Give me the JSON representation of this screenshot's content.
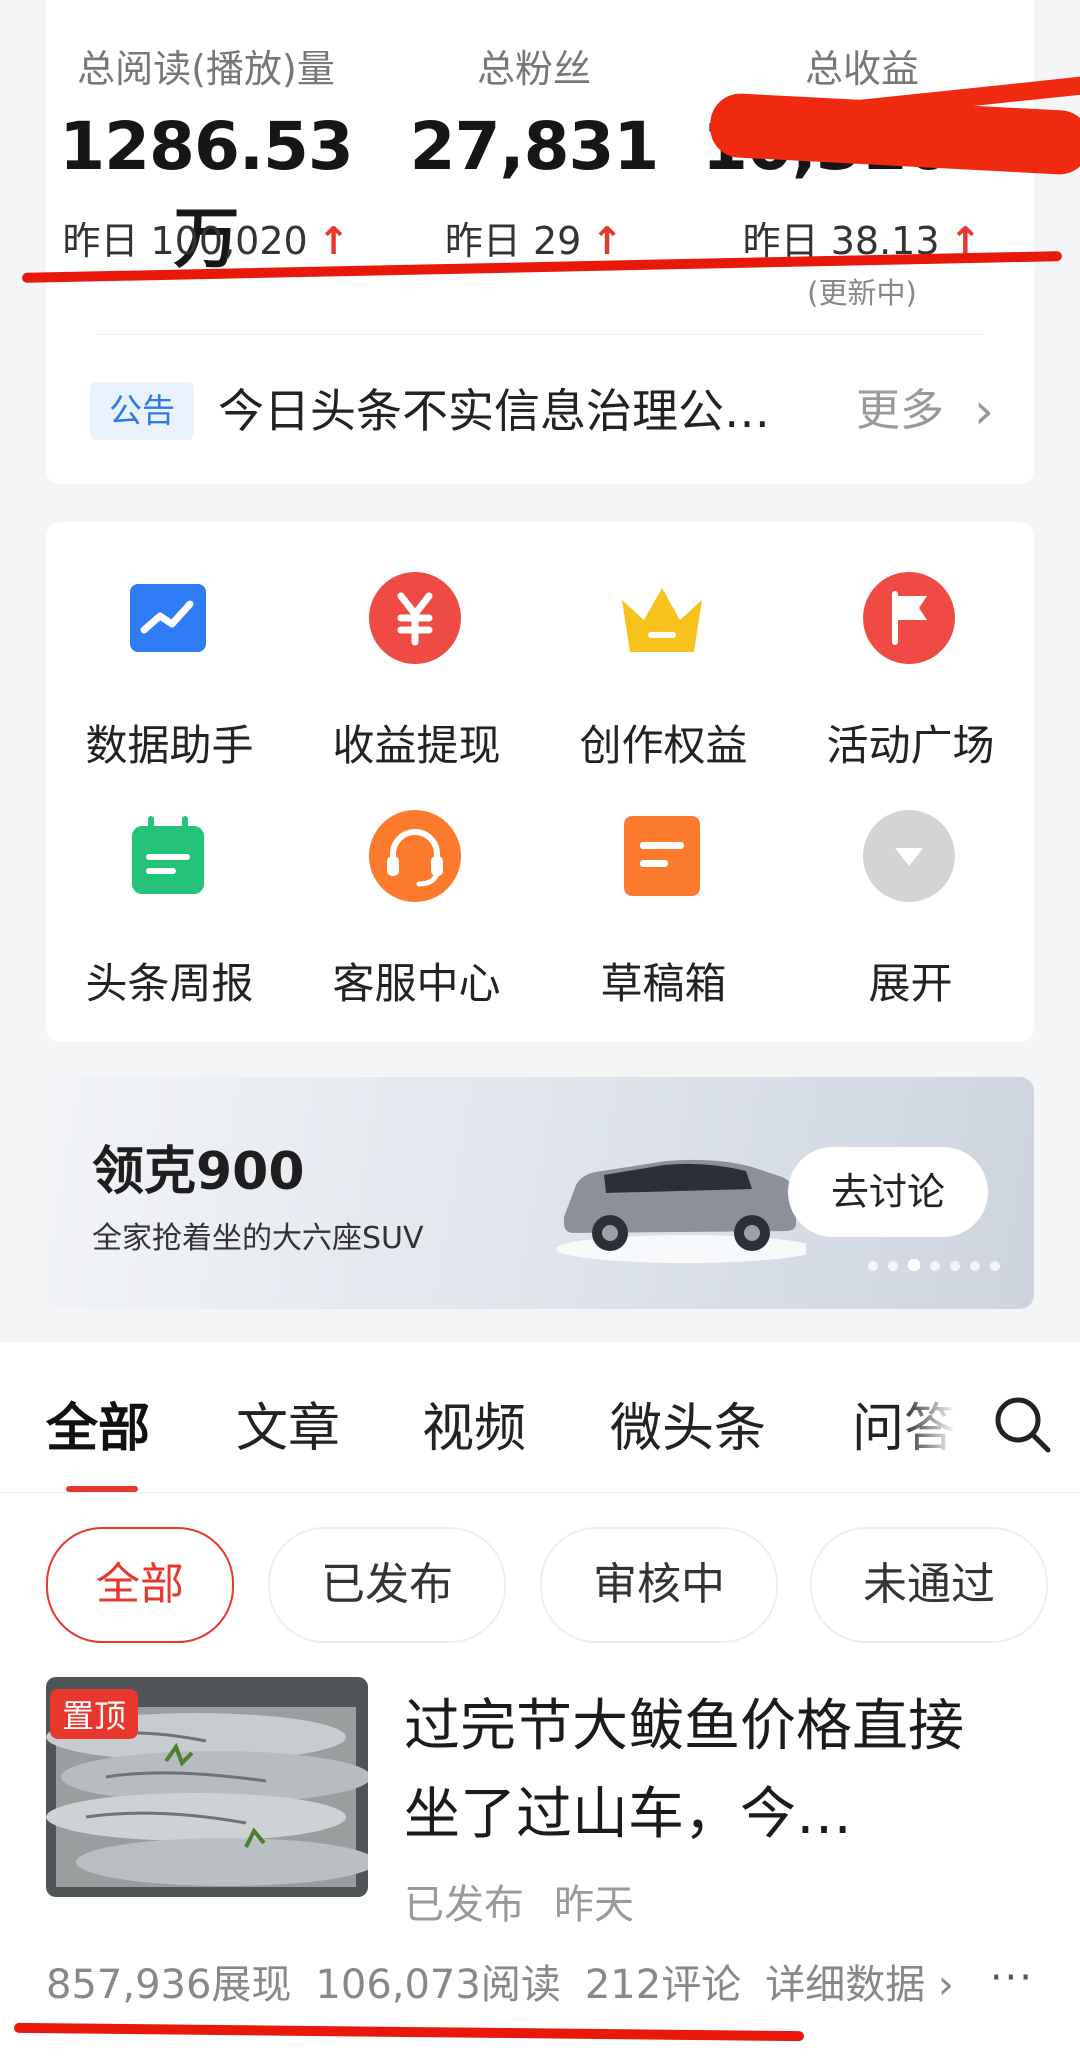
{
  "stats": {
    "items": [
      {
        "label": "总阅读(播放)量",
        "value": "1286.53万",
        "yesterday": "昨日 100,020",
        "arrow": "↑"
      },
      {
        "label": "总粉丝",
        "value": "27,831",
        "yesterday": "昨日 29",
        "arrow": "↑"
      },
      {
        "label": "总收益",
        "value": "10,310.28",
        "yesterday": "昨日 38.13",
        "arrow": "↑",
        "note": "(更新中)"
      }
    ]
  },
  "notice": {
    "tag": "公告",
    "text": "今日头条不实信息治理公…",
    "more": "更多",
    "chevron": "›"
  },
  "tools": [
    {
      "label": "数据助手",
      "icon": "chart-trend-icon",
      "color": "#2f7cf6"
    },
    {
      "label": "收益提现",
      "icon": "yuan-icon",
      "color": "#f04a45"
    },
    {
      "label": "创作权益",
      "icon": "crown-icon",
      "color": "#f7c21b"
    },
    {
      "label": "活动广场",
      "icon": "flag-icon",
      "color": "#f04a45"
    },
    {
      "label": "头条周报",
      "icon": "calendar-icon",
      "color": "#25c27a"
    },
    {
      "label": "客服中心",
      "icon": "headset-icon",
      "color": "#fb7a2c"
    },
    {
      "label": "草稿箱",
      "icon": "draft-icon",
      "color": "#fb7a2c"
    },
    {
      "label": "展开",
      "icon": "chevron-down-icon",
      "color": "#cfcfcf"
    }
  ],
  "banner": {
    "title": "领克900",
    "subtitle": "全家抢着坐的大六座SUV",
    "button": "去讨论",
    "dots_total": 7,
    "dots_active": 3
  },
  "tabs": {
    "items": [
      "全部",
      "文章",
      "视频",
      "微头条",
      "问答"
    ],
    "active": 0
  },
  "filters": {
    "items": [
      "全部",
      "已发布",
      "审核中",
      "未通过"
    ],
    "active": 0
  },
  "article": {
    "badge": "置顶",
    "title": "过完节大鲅鱼价格直接坐了过山车，今…",
    "status": "已发布",
    "time": "昨天",
    "impressions": "857,936展现",
    "reads": "106,073阅读",
    "comments": "212评论",
    "detail": "详细数据 ›",
    "more": "···"
  },
  "colors": {
    "accent": "#e8382d",
    "link": "#2f7ce0"
  }
}
